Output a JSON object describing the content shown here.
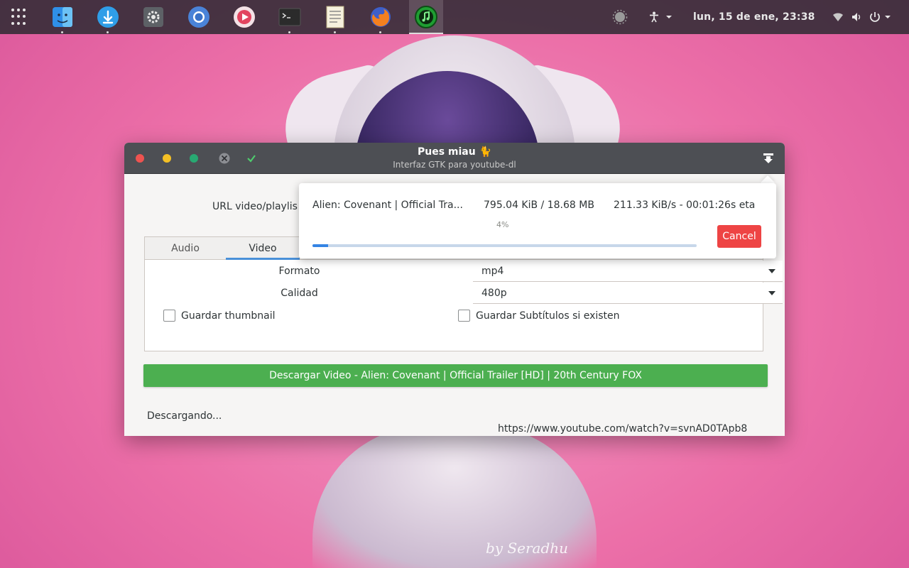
{
  "topbar": {
    "clock": "lun, 15 de ene, 23:38",
    "dock_apps": [
      "finder-icon",
      "downloader-icon",
      "settings-icon",
      "chromium-icon",
      "media-player-icon",
      "terminal-icon",
      "text-editor-icon",
      "firefox-icon",
      "music-app-icon"
    ],
    "tray_icons": [
      "weather-icon",
      "accessibility-icon",
      "wifi-icon",
      "volume-icon",
      "power-icon"
    ]
  },
  "window": {
    "title": "Pues miau 🐈",
    "subtitle": "Interfaz GTK para youtube-dl",
    "url_label": "URL video/playlis",
    "tabs": [
      {
        "label": "Audio",
        "active": false
      },
      {
        "label": "Video",
        "active": true
      }
    ],
    "fields": {
      "formato_label": "Formato",
      "formato_value": "mp4",
      "calidad_label": "Calidad",
      "calidad_value": "480p",
      "thumbnail_label": "Guardar thumbnail",
      "subtitles_label": "Guardar Subtítulos si existen"
    },
    "download_button": "Descargar Video - Alien: Covenant | Official Trailer [HD] | 20th Century FOX",
    "status": "Descargando...",
    "url": "https://www.youtube.com/watch?v=svnAD0TApb8"
  },
  "popover": {
    "video_title": "Alien: Covenant | Official Tra...",
    "size": "795.04 KiB / 18.68 MB",
    "speed_eta": "211.33 KiB/s - 00:01:26s eta",
    "percent": "4%",
    "progress": 0.04,
    "cancel": "Cancel"
  },
  "colors": {
    "download_button": "#4caf50",
    "cancel_button": "#ee4444",
    "progress": "#3584e4",
    "headerbar": "#4d4f54"
  },
  "signature": "by Seradhu"
}
